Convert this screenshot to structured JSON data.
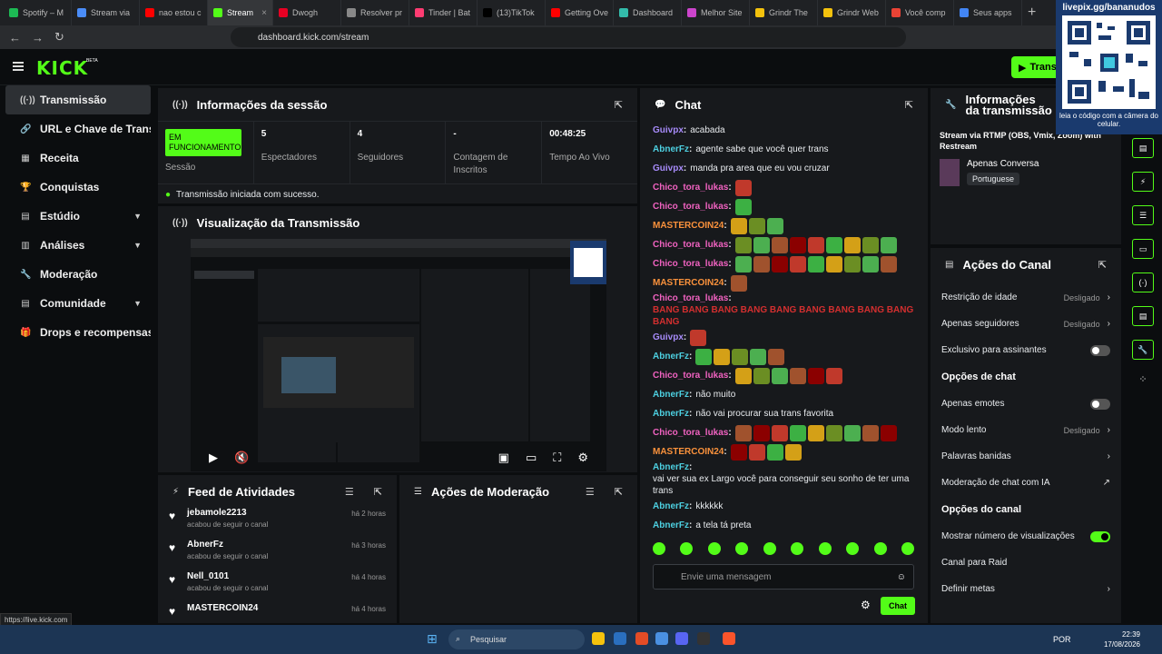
{
  "browser": {
    "tabs": [
      {
        "label": "Spotify – M",
        "color": "#1db954"
      },
      {
        "label": "Stream via",
        "color": "#4a8cf7"
      },
      {
        "label": "nao estou c",
        "color": "#ff0000"
      },
      {
        "label": "Stream",
        "color": "#53fc18",
        "active": true
      },
      {
        "label": "Dwogh",
        "color": "#e60023"
      },
      {
        "label": "Resolver pr",
        "color": "#888"
      },
      {
        "label": "Tinder | Bat",
        "color": "#fe3c72"
      },
      {
        "label": "(13)TikTok",
        "color": "#000"
      },
      {
        "label": "Getting Ove",
        "color": "#ff0000"
      },
      {
        "label": "Dashboard",
        "color": "#33bbaa"
      },
      {
        "label": "Melhor Site",
        "color": "#cc44cc"
      },
      {
        "label": "Grindr The",
        "color": "#f4c20d"
      },
      {
        "label": "Grindr Web",
        "color": "#f4c20d"
      },
      {
        "label": "Você comp",
        "color": "#ea4335"
      },
      {
        "label": "Seus apps",
        "color": "#4285f4"
      }
    ],
    "url": "dashboard.kick.com/stream"
  },
  "topbar": {
    "logo": "KICK",
    "beta": "BETA",
    "broadcast_button": "Transm"
  },
  "sidebar": {
    "items": [
      {
        "label": "Transmissão",
        "icon": "broadcast-icon",
        "active": true
      },
      {
        "label": "URL e Chave de Transmissão",
        "icon": "link-icon"
      },
      {
        "label": "Receita",
        "icon": "revenue-icon"
      },
      {
        "label": "Conquistas",
        "icon": "trophy-icon"
      },
      {
        "label": "Estúdio",
        "icon": "studio-icon",
        "chevron": true
      },
      {
        "label": "Análises",
        "icon": "chart-icon",
        "chevron": true
      },
      {
        "label": "Moderação",
        "icon": "wrench-icon"
      },
      {
        "label": "Comunidade",
        "icon": "community-icon",
        "chevron": true
      },
      {
        "label": "Drops e recompensas",
        "icon": "gift-icon"
      }
    ]
  },
  "session": {
    "title": "Informações da sessão",
    "status_badge": "EM FUNCIONAMENTO",
    "status_label": "Sessão",
    "viewers": "5",
    "viewers_label": "Espectadores",
    "followers": "4",
    "followers_label": "Seguidores",
    "subs": "-",
    "subs_label": "Contagem de Inscritos",
    "live_time": "00:48:25",
    "live_time_label": "Tempo Ao Vivo",
    "success": "Transmissão iniciada com sucesso."
  },
  "preview": {
    "title": "Visualização da Transmissão"
  },
  "feed": {
    "title": "Feed de Atividades",
    "items": [
      {
        "name": "jebamole2213",
        "action": "acabou de seguir o canal",
        "time": "há 2 horas"
      },
      {
        "name": "AbnerFz",
        "action": "acabou de seguir o canal",
        "time": "há 3 horas"
      },
      {
        "name": "Nell_0101",
        "action": "acabou de seguir o canal",
        "time": "há 4 horas"
      },
      {
        "name": "MASTERCOIN24",
        "action": "",
        "time": "há 4 horas"
      }
    ]
  },
  "moderation": {
    "title": "Ações de Moderação"
  },
  "chat": {
    "title": "Chat",
    "messages": [
      {
        "user": "Guivpx",
        "color": "#a78bfa",
        "text": "acabada"
      },
      {
        "user": "AbnerFz",
        "color": "#4dd0e1",
        "text": "agente sabe que você quer trans"
      },
      {
        "user": "Guivpx",
        "color": "#a78bfa",
        "text": "manda pra area que eu vou cruzar"
      },
      {
        "user": "Chico_tora_lukas",
        "color": "#f062c0",
        "emotes": 1
      },
      {
        "user": "Chico_tora_lukas",
        "color": "#f062c0",
        "emotes": 1
      },
      {
        "user": "MASTERCOIN24",
        "color": "#fb923c",
        "emotes": 3
      },
      {
        "user": "Chico_tora_lukas",
        "color": "#f062c0",
        "emotes": 9
      },
      {
        "user": "Chico_tora_lukas",
        "color": "#f062c0",
        "emotes": 9
      },
      {
        "user": "MASTERCOIN24",
        "color": "#fb923c",
        "emotes": 1
      },
      {
        "user": "Chico_tora_lukas",
        "color": "#f062c0",
        "text": "BANG BANG BANG BANG BANG BANG BANG BANG BANG BANG",
        "bang": true
      },
      {
        "user": "Guivpx",
        "color": "#a78bfa",
        "emotes": 1
      },
      {
        "user": "AbnerFz",
        "color": "#4dd0e1",
        "emotes": 5
      },
      {
        "user": "Chico_tora_lukas",
        "color": "#f062c0",
        "emotes": 6
      },
      {
        "user": "AbnerFz",
        "color": "#4dd0e1",
        "text": "não muito"
      },
      {
        "user": "AbnerFz",
        "color": "#4dd0e1",
        "text": "não vai procurar sua trans favorita"
      },
      {
        "user": "Chico_tora_lukas",
        "color": "#f062c0",
        "emotes": 9
      },
      {
        "user": "MASTERCOIN24",
        "color": "#fb923c",
        "emotes": 4
      },
      {
        "user": "AbnerFz",
        "color": "#4dd0e1",
        "text": "vai ver sua ex Largo você para conseguir seu sonho de ter uma trans"
      },
      {
        "user": "AbnerFz",
        "color": "#4dd0e1",
        "text": "kkkkkk"
      },
      {
        "user": "AbnerFz",
        "color": "#4dd0e1",
        "text": "a tela tá preta"
      }
    ],
    "input_placeholder": "Envie uma mensagem",
    "send_label": "Chat"
  },
  "stream_info": {
    "title": "Informações da transmissão",
    "via": "Stream via RTMP (OBS, Vmix, Zoom) with Restream",
    "category": "Apenas Conversa",
    "language": "Portuguese"
  },
  "channel_actions": {
    "title": "Ações do Canal",
    "items": [
      {
        "label": "Restrição de idade",
        "value": "Desligado",
        "type": "arrow"
      },
      {
        "label": "Apenas seguidores",
        "value": "Desligado",
        "type": "arrow"
      },
      {
        "label": "Exclusivo para assinantes",
        "type": "toggle",
        "on": false
      }
    ],
    "chat_options_title": "Opções de chat",
    "chat_options": [
      {
        "label": "Apenas emotes",
        "type": "toggle",
        "on": false
      },
      {
        "label": "Modo lento",
        "value": "Desligado",
        "type": "arrow"
      },
      {
        "label": "Palavras banidas",
        "type": "arrow"
      },
      {
        "label": "Moderação de chat com IA",
        "type": "ext"
      }
    ],
    "channel_options_title": "Opções do canal",
    "channel_options": [
      {
        "label": "Mostrar número de visualizações",
        "type": "toggle",
        "on": true
      },
      {
        "label": "Canal para Raid",
        "type": "none"
      },
      {
        "label": "Definir metas",
        "type": "arrow"
      }
    ]
  },
  "qr": {
    "title": "livepix.gg/bananudos",
    "footer": "leia o código com a câmera do celular."
  },
  "statusbar": {
    "text": "https://live.kick.com"
  },
  "taskbar": {
    "search": "Pesquisar",
    "lang": "POR",
    "time": "22:39",
    "date": "17/08/2026"
  }
}
